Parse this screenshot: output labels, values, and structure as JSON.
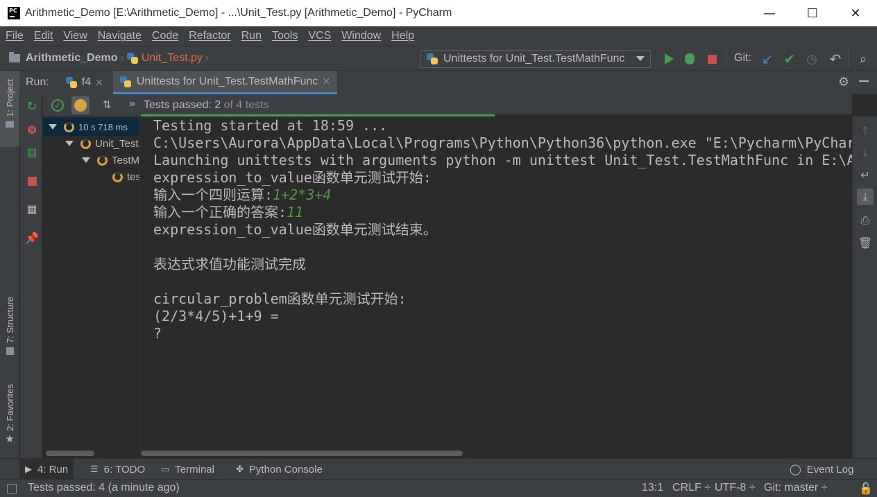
{
  "window": {
    "title": "Arithmetic_Demo [E:\\Arithmetic_Demo] - ...\\Unit_Test.py [Arithmetic_Demo] - PyCharm",
    "logo_text": "PC",
    "minimize": "—",
    "maximize": "☐",
    "close": "✕"
  },
  "menu": [
    "File",
    "Edit",
    "View",
    "Navigate",
    "Code",
    "Refactor",
    "Run",
    "Tools",
    "VCS",
    "Window",
    "Help"
  ],
  "nav": {
    "project": "Arithmetic_Demo",
    "file": "Unit_Test.py",
    "run_config": "Unittests for Unit_Test.TestMathFunc",
    "git_label": "Git:"
  },
  "run_window": {
    "label": "Run:",
    "tabs": [
      {
        "label": "f4",
        "close": "✕"
      },
      {
        "label": "Unittests for Unit_Test.TestMathFunc",
        "close": "✕"
      }
    ],
    "status_passed": "Tests passed:",
    "status_count": "2",
    "status_rest": "of 4 tests"
  },
  "tree": {
    "root_time": "10 s 718 ms",
    "level1": "Unit_Test",
    "level2": "TestMathFunc",
    "level3": "test"
  },
  "console": {
    "lines": [
      "Testing started at 18:59 ...",
      "C:\\Users\\Aurora\\AppData\\Local\\Programs\\Python\\Python36\\python.exe \"E:\\Pycharm\\PyCharm",
      "Launching unittests with arguments python -m unittest Unit_Test.TestMathFunc in E:\\Arithmetic_Demo",
      "expression_to_value函数单元测试开始:"
    ],
    "prompt1": "输入一个四则运算:",
    "input1": "1+2*3+4",
    "prompt2": "输入一个正确的答案:",
    "input2": "11",
    "lines2": [
      "expression_to_value函数单元测试结束。",
      "",
      "表达式求值功能测试完成",
      "",
      "circular_problem函数单元测试开始:",
      "(2/3*4/5)+1+9 =",
      "?"
    ]
  },
  "left_stripe": {
    "project": "1: Project",
    "structure": "7: Structure",
    "favorites": "2: Favorites"
  },
  "bottom_tabs": {
    "run": "4: Run",
    "todo": "6: TODO",
    "terminal": "Terminal",
    "python_console": "Python Console",
    "event_log": "Event Log"
  },
  "statusbar": {
    "message": "Tests passed: 4 (a minute ago)",
    "position": "13:1",
    "line_sep": "CRLF ÷",
    "encoding": "UTF-8 ÷",
    "git_branch": "Git: master ÷"
  },
  "colors": {
    "accent": "#4a88c7",
    "run_green": "#499c54",
    "stop_red": "#c75450",
    "file_red": "#e06c4c",
    "input_green": "#4c9b3e"
  }
}
